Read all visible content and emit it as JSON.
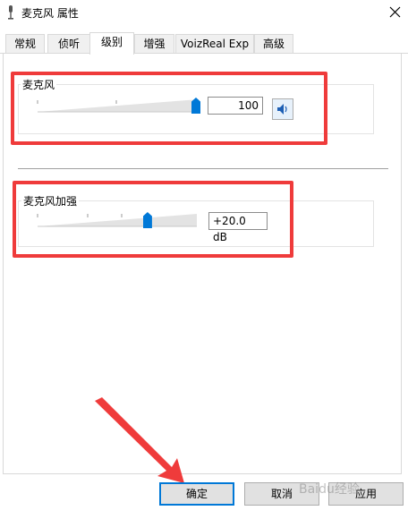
{
  "window": {
    "title": "麦克风 属性",
    "close_glyph": "✕"
  },
  "tabs": [
    {
      "label": "常规"
    },
    {
      "label": "侦听"
    },
    {
      "label": "级别"
    },
    {
      "label": "增强"
    },
    {
      "label": "VoizReal Exp"
    },
    {
      "label": "高级"
    }
  ],
  "active_tab": "级别",
  "levels": {
    "microphone": {
      "label": "麦克风",
      "value_text": "100",
      "level": 100,
      "mute_button_icon": "speaker-icon"
    },
    "boost": {
      "label": "麦克风加强",
      "value_text": "+20.0 dB",
      "level_fraction": 0.67
    }
  },
  "buttons": {
    "ok": "确定",
    "cancel": "取消",
    "apply": "应用"
  },
  "watermark": "Baidu经验",
  "colors": {
    "accent": "#0078d7",
    "annotation": "#ef3b3b"
  }
}
